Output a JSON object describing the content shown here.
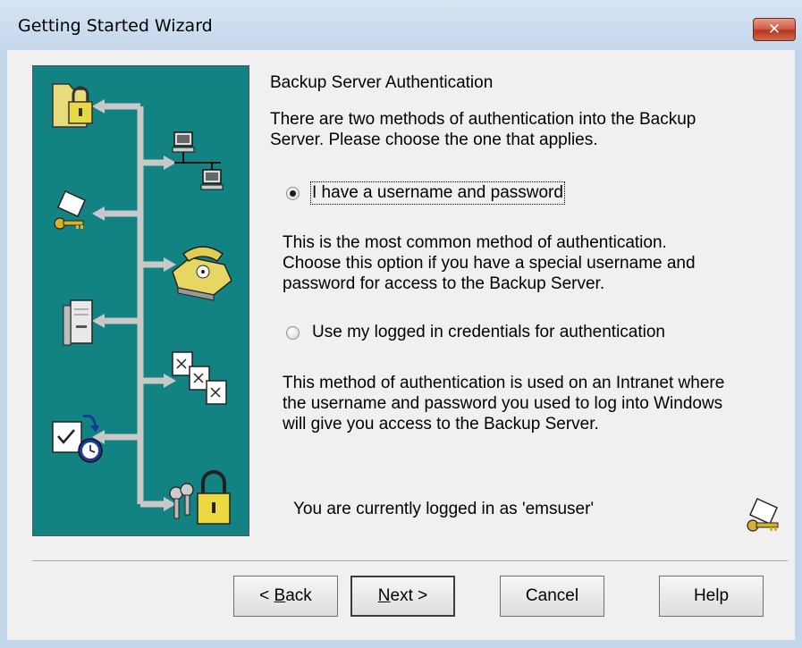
{
  "window": {
    "title": "Getting Started Wizard",
    "close_icon": "close-icon",
    "close_glyph": "✕"
  },
  "banner": {
    "background": "#128283",
    "icons": [
      "folder-lock-icon",
      "network-computers-icon",
      "key-icon",
      "telephone-icon",
      "server-icon",
      "documents-icon",
      "scheduled-task-icon",
      "keys-lock-icon"
    ]
  },
  "page": {
    "heading": "Backup Server Authentication",
    "intro_line1": "There are two methods of authentication into the Backup",
    "intro_line2": "Server.  Please choose the one that applies.",
    "option1": {
      "label": "I have a username and password",
      "checked": true,
      "desc_line1": "This is the most common method of authentication.",
      "desc_line2": "Choose this option if you have a special username and",
      "desc_line3": "password for access to the Backup Server."
    },
    "option2": {
      "label": "Use my logged in credentials for authentication",
      "checked": false,
      "desc_line1": "This method of authentication is used on an Intranet where",
      "desc_line2": "the username and password you used to log into Windows",
      "desc_line3": "will give you access to the Backup Server."
    },
    "status": "You are currently logged in as 'emsuser'",
    "status_icon": "key-icon"
  },
  "buttons": {
    "back_mnemonic": "B",
    "back_prefix": "< ",
    "back_rest": "ack",
    "next_mnemonic": "N",
    "next_rest": "ext >",
    "cancel": "Cancel",
    "help": "Help"
  }
}
